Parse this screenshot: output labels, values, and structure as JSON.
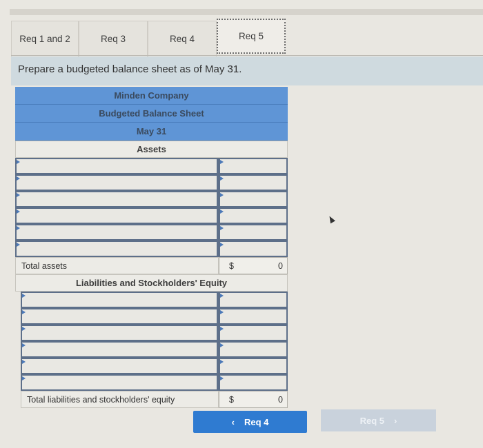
{
  "tabs": [
    {
      "label": "Req 1 and 2",
      "active": false
    },
    {
      "label": "Req 3",
      "active": false
    },
    {
      "label": "Req 4",
      "active": false
    },
    {
      "label": "Req 5",
      "active": true
    }
  ],
  "instruction": "Prepare a budgeted balance sheet as of May 31.",
  "sheet": {
    "company": "Minden Company",
    "title": "Budgeted Balance Sheet",
    "date": "May 31",
    "assets_heading": "Assets",
    "asset_rows": [
      {
        "label": "",
        "amount": ""
      },
      {
        "label": "",
        "amount": ""
      },
      {
        "label": "",
        "amount": ""
      },
      {
        "label": "",
        "amount": ""
      },
      {
        "label": "",
        "amount": ""
      },
      {
        "label": "",
        "amount": ""
      }
    ],
    "total_assets": {
      "label": "Total assets",
      "currency": "$",
      "value": "0"
    },
    "liabilities_heading": "Liabilities and Stockholders' Equity",
    "liability_rows": [
      {
        "label": "",
        "amount": ""
      },
      {
        "label": "",
        "amount": ""
      },
      {
        "label": "",
        "amount": ""
      },
      {
        "label": "",
        "amount": ""
      },
      {
        "label": "",
        "amount": ""
      },
      {
        "label": "",
        "amount": ""
      }
    ],
    "total_liabilities": {
      "label": "Total liabilities and stockholders' equity",
      "currency": "$",
      "value": "0"
    }
  },
  "nav": {
    "prev": {
      "icon": "‹",
      "label": "Req 4"
    },
    "next": {
      "icon": "›",
      "label": "Req 5",
      "disabled": true
    }
  }
}
